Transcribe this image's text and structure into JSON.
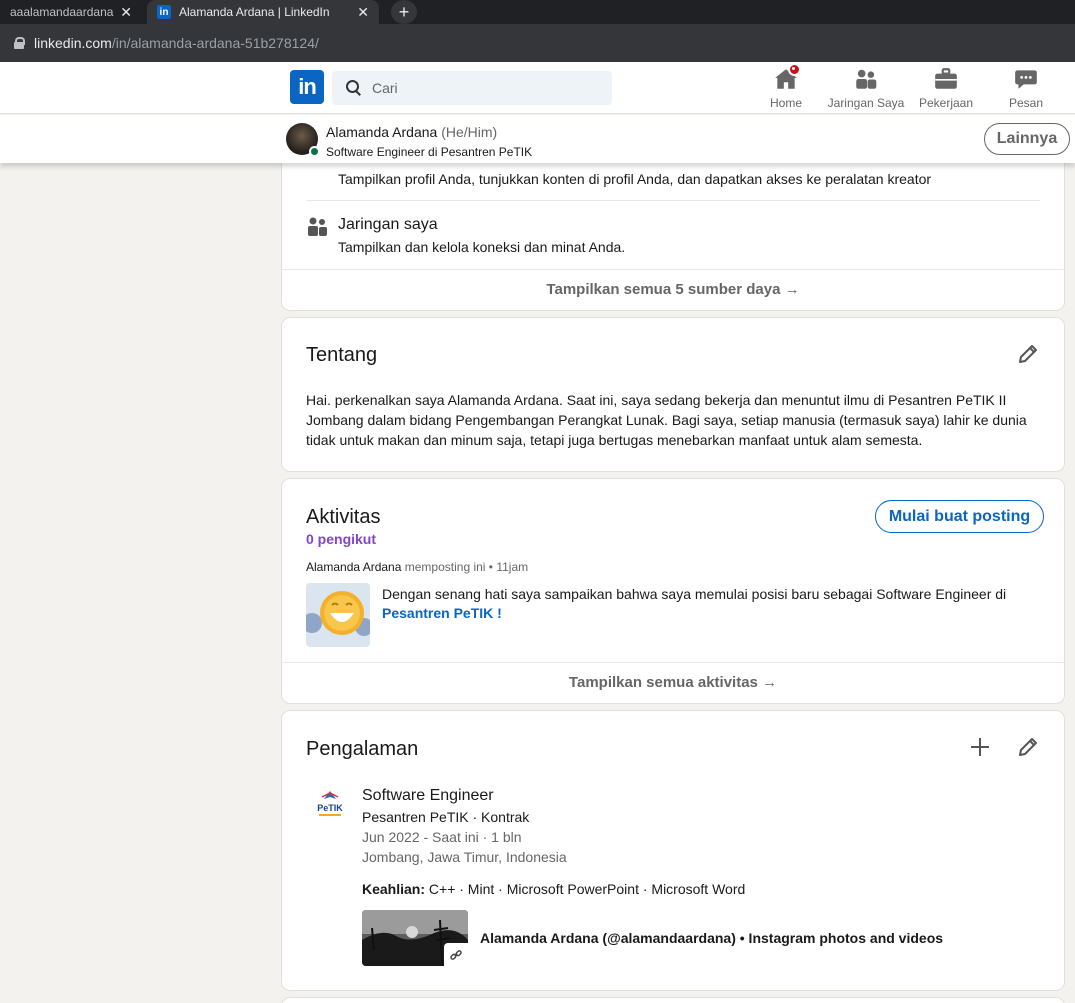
{
  "browser": {
    "tabs": [
      {
        "title": "aaalamandaardana",
        "active": false
      },
      {
        "title": "Alamanda Ardana | LinkedIn",
        "active": true
      }
    ],
    "tab_close": "✕",
    "new_tab": "+",
    "url_domain": "linkedin.com",
    "url_path": "/in/alamanda-ardana-51b278124/"
  },
  "header": {
    "logo_text": "in",
    "search_placeholder": "Cari",
    "nav": [
      {
        "label": "Home",
        "icon": "home-icon",
        "badge": true
      },
      {
        "label": "Jaringan Saya",
        "icon": "network-icon"
      },
      {
        "label": "Pekerjaan",
        "icon": "briefcase-icon"
      },
      {
        "label": "Pesan",
        "icon": "message-icon"
      }
    ]
  },
  "sticky": {
    "name": "Alamanda Ardana",
    "pronouns": "(He/Him)",
    "headline": "Software Engineer di Pesantren PeTIK",
    "more_button": "Lainnya"
  },
  "resources": {
    "item1_subtitle": "Tampilkan profil Anda, tunjukkan konten di profil Anda, dan dapatkan akses ke peralatan kreator",
    "item2_title": "Jaringan saya",
    "item2_subtitle": "Tampilkan dan kelola koneksi dan minat Anda.",
    "footer": "Tampilkan semua 5 sumber daya →"
  },
  "about": {
    "title": "Tentang",
    "text": "Hai. perkenalkan saya Alamanda Ardana. Saat ini, saya sedang bekerja dan menuntut ilmu di Pesantren PeTIK II Jombang dalam bidang Pengembangan Perangkat Lunak. Bagi saya, setiap manusia (termasuk saya) lahir ke dunia tidak untuk makan dan minum saja, tetapi juga bertugas menebarkan manfaat untuk alam semesta."
  },
  "activity": {
    "title": "Aktivitas",
    "followers": "0 pengikut",
    "start_post_button": "Mulai buat posting",
    "post_author": "Alamanda Ardana",
    "post_meta": "memposting ini • 11jam",
    "post_text": "Dengan senang hati saya sampaikan bahwa saya memulai posisi baru sebagai Software Engineer di",
    "post_link": "Pesantren PeTIK",
    "post_end": " !",
    "footer": "Tampilkan semua aktivitas →"
  },
  "experience": {
    "title": "Pengalaman",
    "logo_text": "PeTIK",
    "job_title": "Software Engineer",
    "company": "Pesantren PeTIK · Kontrak",
    "dates": "Jun 2022 - Saat ini · 1 bln",
    "location": "Jombang, Jawa Timur, Indonesia",
    "skills_label": "Keahlian:",
    "skills": " C++ · Mint · Microsoft PowerPoint · Microsoft Word",
    "media_title": "Alamanda Ardana (@alamandaardana) • Instagram photos and videos"
  },
  "colors": {
    "brand": "#0a66c2",
    "followers": "#8344cc",
    "badge": "#cc1016",
    "online": "#057642"
  }
}
